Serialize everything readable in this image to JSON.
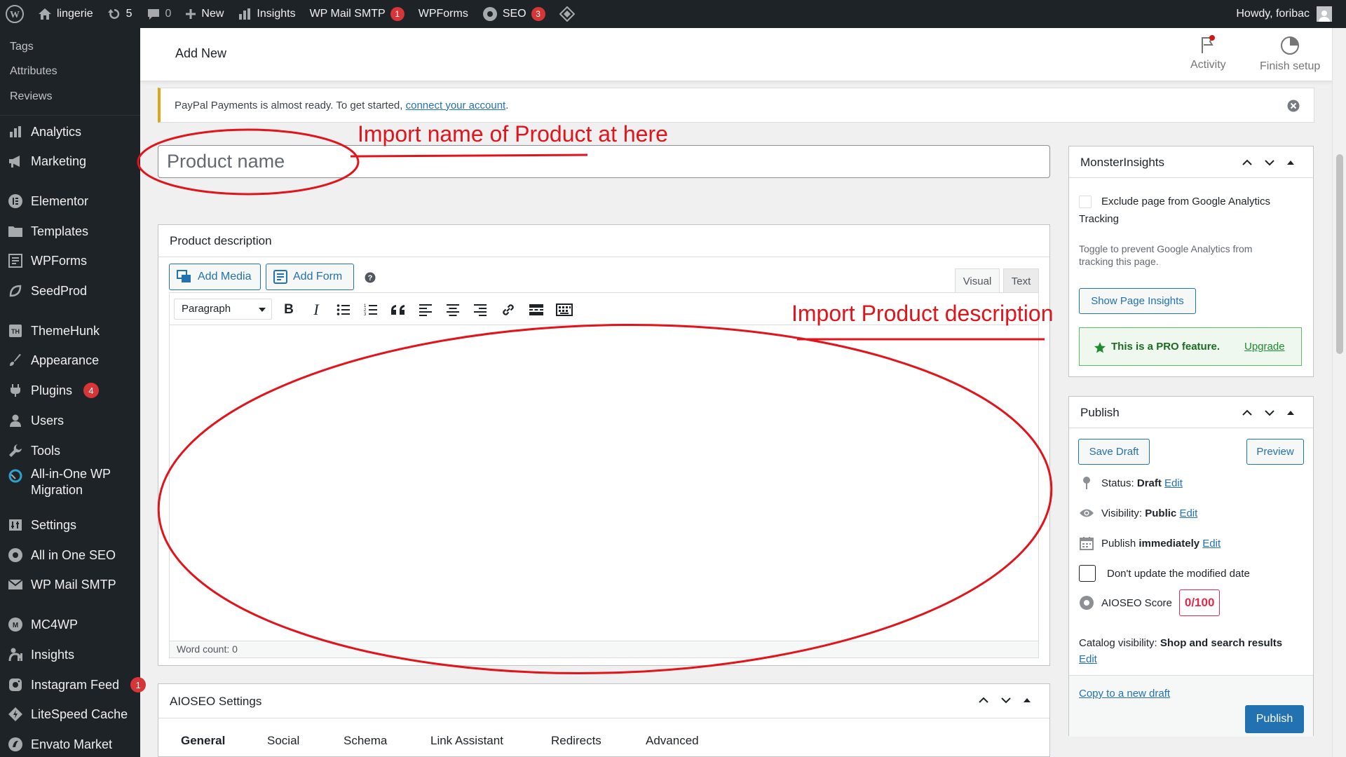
{
  "admin_bar": {
    "site_name": "lingerie",
    "updates_count": "5",
    "comments_count": "0",
    "new_label": "New",
    "insights_label": "Insights",
    "wpmail_label": "WP Mail SMTP",
    "wpmail_badge": "1",
    "wpforms_label": "WPForms",
    "seo_label": "SEO",
    "seo_badge": "3",
    "howdy": "Howdy, foribac"
  },
  "sidebar": {
    "sub_items": [
      "Tags",
      "Attributes",
      "Reviews"
    ],
    "items": [
      {
        "label": "Analytics",
        "icon": "bar-chart-icon"
      },
      {
        "label": "Marketing",
        "icon": "megaphone-icon"
      },
      {
        "label": "Elementor",
        "icon": "elementor-icon"
      },
      {
        "label": "Templates",
        "icon": "folder-icon"
      },
      {
        "label": "WPForms",
        "icon": "form-icon"
      },
      {
        "label": "SeedProd",
        "icon": "seedprod-icon"
      },
      {
        "label": "ThemeHunk",
        "icon": "themehunk-icon"
      },
      {
        "label": "Appearance",
        "icon": "brush-icon"
      },
      {
        "label": "Plugins",
        "icon": "plugin-icon",
        "badge": "4"
      },
      {
        "label": "Users",
        "icon": "user-icon"
      },
      {
        "label": "Tools",
        "icon": "wrench-icon"
      },
      {
        "label": "All-in-One WP",
        "label2": "Migration",
        "icon": "migration-icon"
      },
      {
        "label": "Settings",
        "icon": "settings-icon"
      },
      {
        "label": "All in One SEO",
        "icon": "aioseo-icon"
      },
      {
        "label": "WP Mail SMTP",
        "icon": "mail-icon"
      },
      {
        "label": "MC4WP",
        "icon": "mc4wp-icon"
      },
      {
        "label": "Insights",
        "icon": "insights-icon"
      },
      {
        "label": "Instagram Feed",
        "icon": "instagram-icon",
        "badge": "1"
      },
      {
        "label": "LiteSpeed Cache",
        "icon": "litespeed-icon"
      },
      {
        "label": "Envato Market",
        "icon": "envato-icon"
      }
    ]
  },
  "header": {
    "title": "Add New",
    "activity_label": "Activity",
    "finish_label": "Finish setup"
  },
  "notice": {
    "text": "PayPal Payments is almost ready. To get started, ",
    "link": "connect your account",
    "end": "."
  },
  "title_input": {
    "placeholder": "Product name"
  },
  "description": {
    "heading": "Product description",
    "add_media": "Add Media",
    "add_form": "Add Form",
    "tab_visual": "Visual",
    "tab_text": "Text",
    "format": "Paragraph",
    "word_count": "Word count: 0"
  },
  "aioseo": {
    "title": "AIOSEO Settings",
    "tabs": [
      "General",
      "Social",
      "Schema",
      "Link Assistant",
      "Redirects",
      "Advanced"
    ]
  },
  "monsterinsights": {
    "title": "MonsterInsights",
    "exclude_label_1": "Exclude page from Google Analytics",
    "exclude_label_2": "Tracking",
    "help_1": "Toggle to prevent Google Analytics from",
    "help_2": "tracking this page.",
    "show_insights": "Show Page Insights",
    "pro_text": "This is a PRO feature.",
    "upgrade": "Upgrade"
  },
  "publish": {
    "title": "Publish",
    "save_draft": "Save Draft",
    "preview": "Preview",
    "status_label": "Status: ",
    "status_value": "Draft",
    "visibility_label": "Visibility: ",
    "visibility_value": "Public",
    "publish_label": "Publish ",
    "publish_value": "immediately",
    "edit": "Edit",
    "dont_update": "Don't update the modified date",
    "aioseo_score_label": "AIOSEO Score",
    "aioseo_score": "0/100",
    "catalog_label": "Catalog visibility: ",
    "catalog_value": "Shop and search results",
    "copy_draft": "Copy to a new draft",
    "publish_btn": "Publish"
  },
  "annotations": {
    "name_note": "Import name of Product at here",
    "desc_note": "Import Product description",
    "color": "#e2141b"
  }
}
